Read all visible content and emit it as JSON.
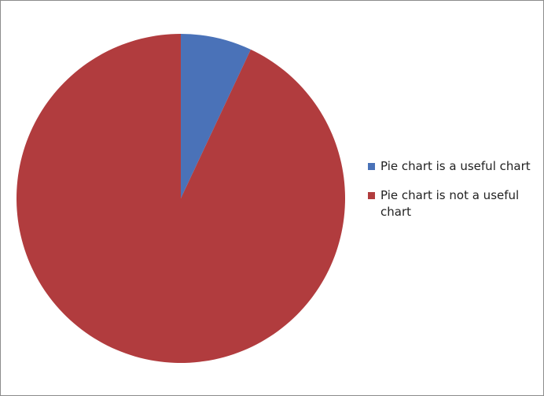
{
  "chart_data": {
    "type": "pie",
    "title": "",
    "categories": [
      "Pie chart is a useful chart",
      "Pie chart is not a useful chart"
    ],
    "values": [
      7,
      93
    ],
    "colors": [
      "#4a72b8",
      "#b13c3e"
    ],
    "start_angle_deg": 0,
    "direction": "clockwise",
    "legend": {
      "position": "right",
      "entries": [
        {
          "label": "Pie chart is a useful chart",
          "color": "#4a72b8"
        },
        {
          "label": "Pie chart is not a useful chart",
          "color": "#b13c3e"
        }
      ]
    }
  }
}
